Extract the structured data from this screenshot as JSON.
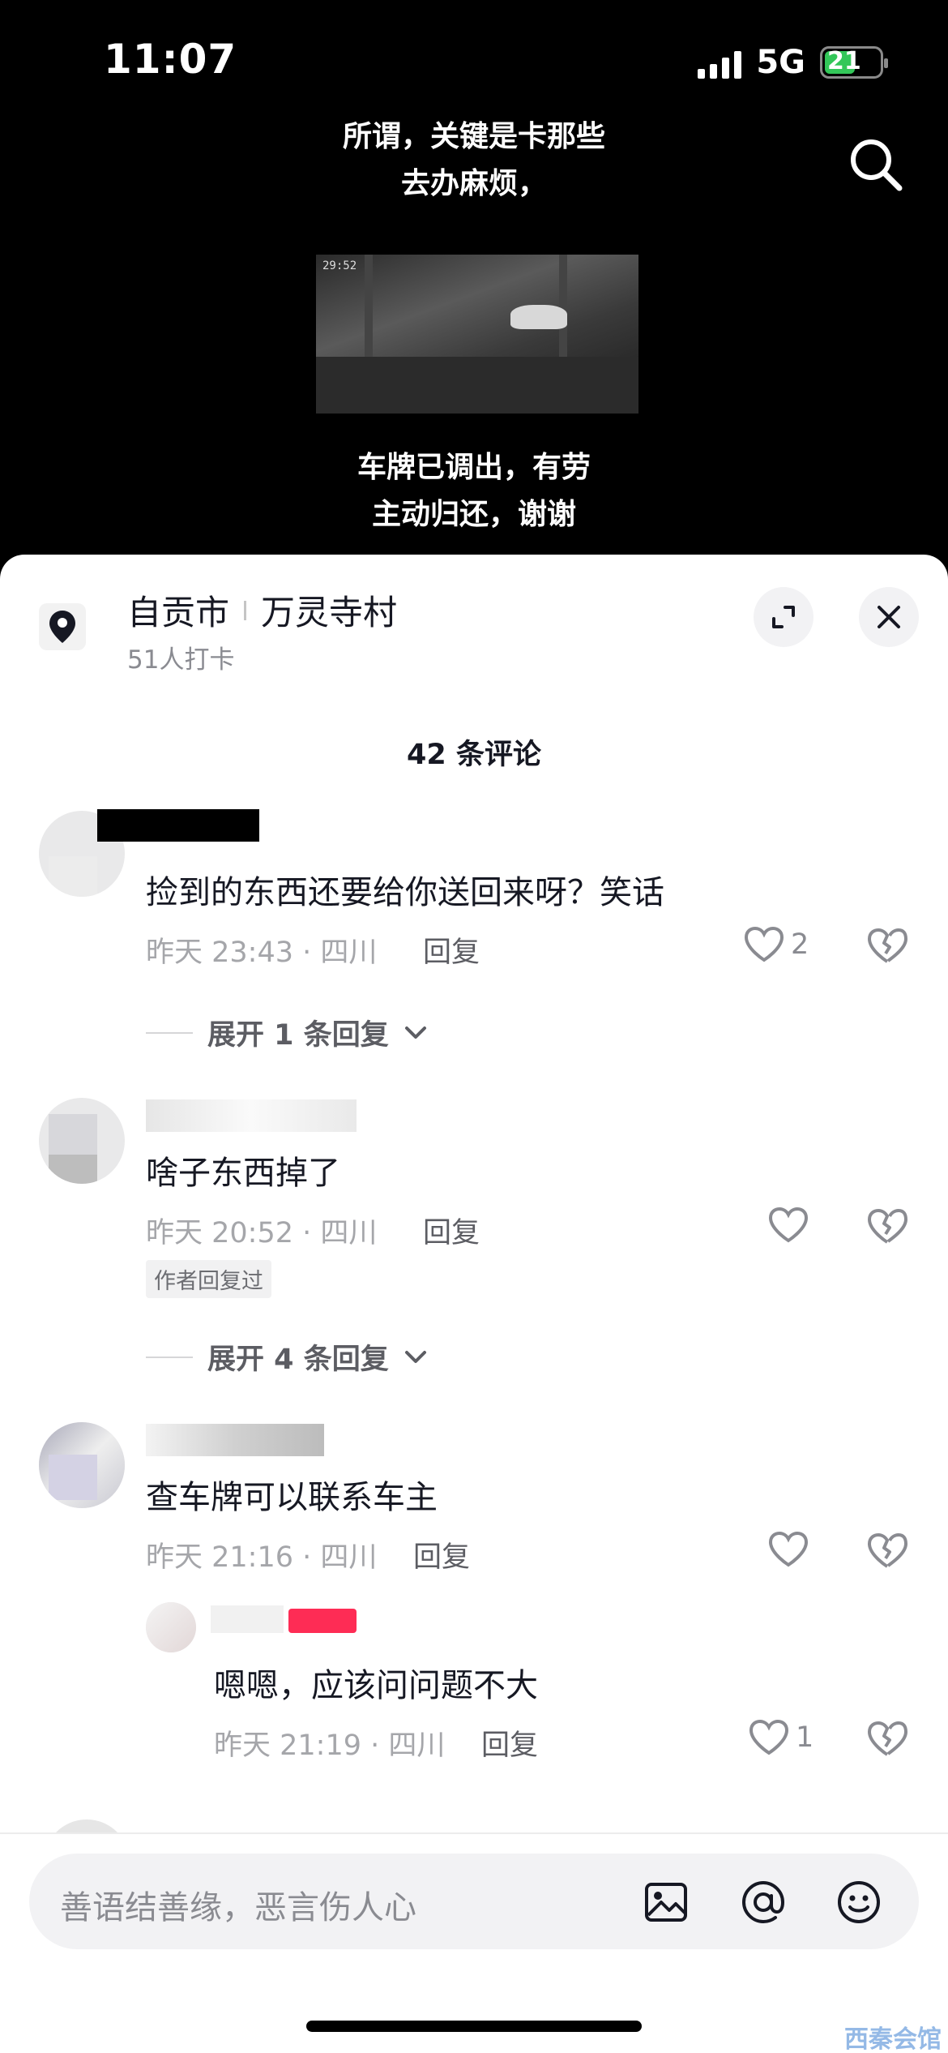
{
  "status": {
    "time": "11:07",
    "network": "5G",
    "battery": "21"
  },
  "video": {
    "subtitle_top": [
      "所谓，关键是卡那些",
      "去办麻烦，"
    ],
    "subtitle_bottom": [
      "车牌已调出，有劳",
      "主动归还，谢谢"
    ],
    "frame_timestamp": "29:52"
  },
  "location": {
    "city": "自贡市",
    "place": "万灵寺村",
    "checkins": "51人打卡"
  },
  "comments_header": "42 条评论",
  "comments": [
    {
      "text": "捡到的东西还要给你送回来呀？笑话",
      "meta": "昨天 23:43 · 四川",
      "reply": "回复",
      "likes": "2",
      "expand": "展开 1 条回复"
    },
    {
      "text": "啥子东西掉了",
      "meta": "昨天 20:52 · 四川",
      "reply": "回复",
      "likes": "",
      "tag": "作者回复过",
      "expand": "展开 4 条回复"
    },
    {
      "text": "查车牌可以联系车主",
      "meta": "昨天 21:16 · 四川",
      "reply": "回复",
      "likes": ""
    }
  ],
  "sub_reply": {
    "text": "嗯嗯，应该问问题不大",
    "meta": "昨天 21:19 · 四川",
    "reply": "回复",
    "likes": "1"
  },
  "input": {
    "placeholder": "善语结善缘，恶言伤人心"
  },
  "watermark": "西秦会馆",
  "colors": {
    "accent": "#fe2c55",
    "text": "#161823",
    "muted": "#a5a6aa"
  }
}
